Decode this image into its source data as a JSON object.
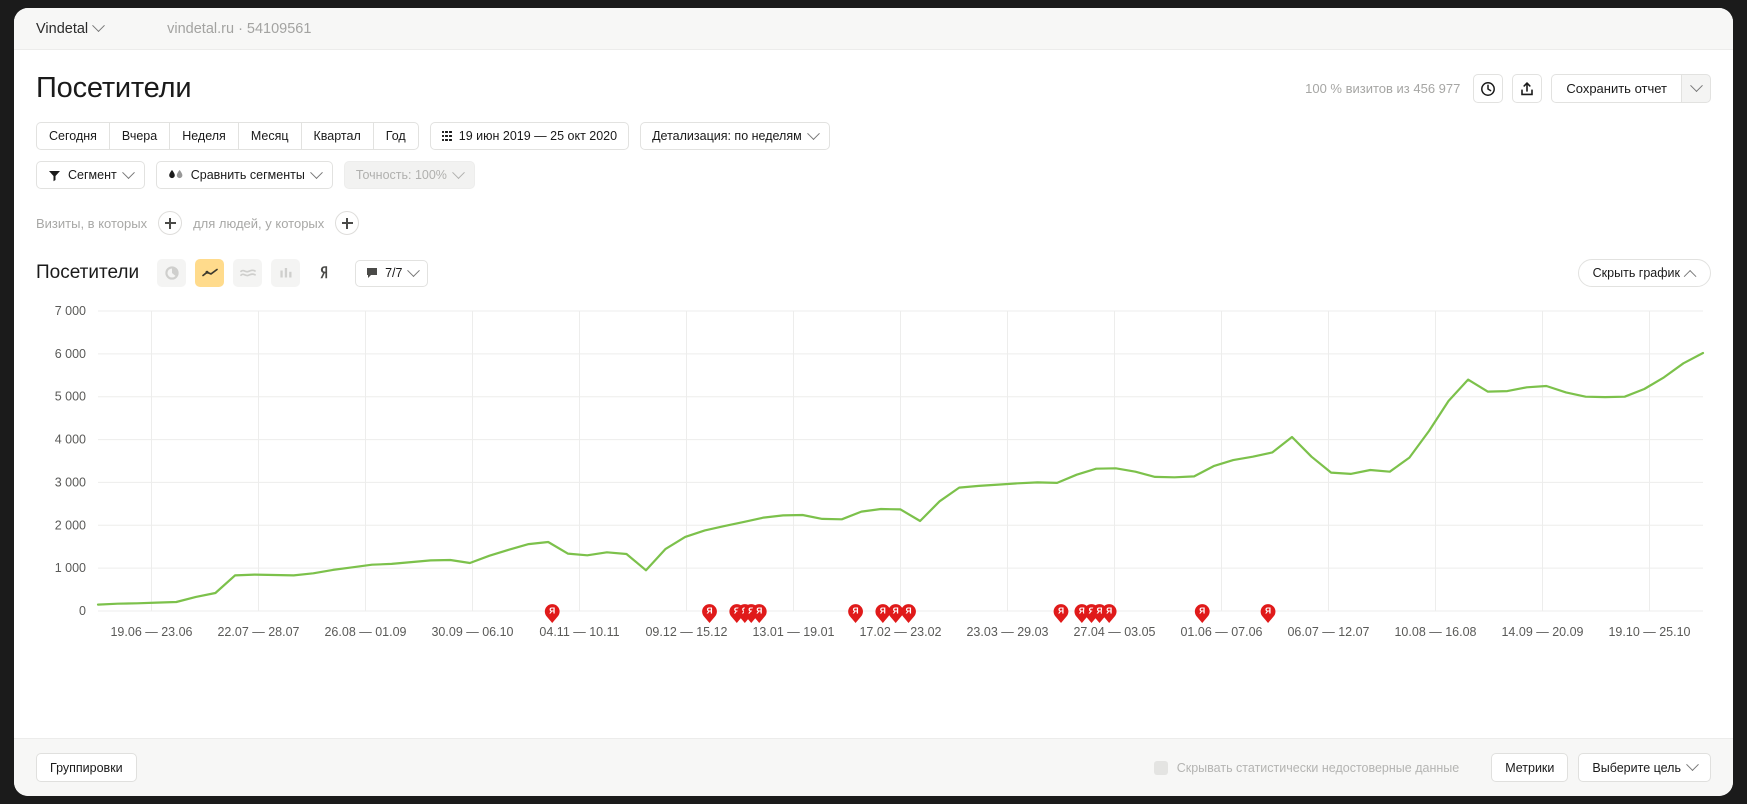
{
  "topbar": {
    "site_label": "Vindetal",
    "site_meta": "vindetal.ru · 54109561"
  },
  "header": {
    "page_title": "Посетители",
    "visits_note": "100 % визитов из 456 977",
    "clock_icon": "clock-icon",
    "share_icon": "share-icon",
    "save_label": "Сохранить отчет"
  },
  "periods": [
    {
      "label": "Сегодня"
    },
    {
      "label": "Вчера"
    },
    {
      "label": "Неделя"
    },
    {
      "label": "Месяц"
    },
    {
      "label": "Квартал"
    },
    {
      "label": "Год"
    }
  ],
  "daterange": {
    "label": "19 июн 2019 — 25 окт 2020",
    "icon": "calendar-grid-icon"
  },
  "detail": {
    "label": "Детализация: по неделям"
  },
  "segments": {
    "segment_label": "Сегмент",
    "compare_label": "Сравнить сегменты",
    "accuracy_label": "Точность: 100%"
  },
  "visit_filter": {
    "visits_text": "Визиты, в которых",
    "people_text": "для людей, у которых"
  },
  "chart_toolbar": {
    "title": "Посетители",
    "types": [
      {
        "name": "pie-chart-icon",
        "active": false
      },
      {
        "name": "line-chart-icon",
        "active": true
      },
      {
        "name": "area-chart-icon",
        "active": false
      },
      {
        "name": "bar-chart-icon",
        "active": false
      },
      {
        "name": "yandex-map-icon",
        "active": false
      }
    ],
    "comments_label": "7/7",
    "hide_chart_label": "Скрыть график"
  },
  "bottom": {
    "groupings_label": "Группировки",
    "hide_unreliable_label": "Скрывать статистически недостоверные данные",
    "metrics_label": "Метрики",
    "goal_label": "Выберите цель"
  },
  "colors": {
    "line": "#7cc14b",
    "accent": "#ffdb8c",
    "marker": "#e01a1a",
    "grid": "#ededec",
    "text": "#1a1a1a",
    "muted": "#a6a6a4"
  },
  "chart_data": {
    "type": "line",
    "title": "Посетители",
    "xlabel": "",
    "ylabel": "",
    "ylim": [
      0,
      7000
    ],
    "yticks": [
      "0",
      "1 000",
      "2 000",
      "3 000",
      "4 000",
      "5 000",
      "6 000",
      "7 000"
    ],
    "grid": true,
    "legend": "none",
    "xtick_labels": [
      "19.06 — 23.06",
      "22.07 — 28.07",
      "26.08 — 01.09",
      "30.09 — 06.10",
      "04.11 — 10.11",
      "09.12 — 15.12",
      "13.01 — 19.01",
      "17.02 — 23.02",
      "23.03 — 29.03",
      "27.04 — 03.05",
      "01.06 — 07.06",
      "06.07 — 12.07",
      "10.08 — 16.08",
      "14.09 — 20.09",
      "19.10 — 25.10"
    ],
    "series": [
      {
        "name": "Посетители",
        "color": "#7cc14b",
        "values": [
          150,
          170,
          180,
          195,
          210,
          330,
          420,
          830,
          850,
          840,
          830,
          880,
          960,
          1020,
          1080,
          1100,
          1140,
          1180,
          1190,
          1120,
          1290,
          1430,
          1560,
          1610,
          1340,
          1300,
          1370,
          1330,
          950,
          1450,
          1730,
          1880,
          1980,
          2080,
          2180,
          2230,
          2240,
          2150,
          2140,
          2320,
          2380,
          2370,
          2100,
          2560,
          2880,
          2920,
          2950,
          2980,
          3000,
          2990,
          3180,
          3320,
          3330,
          3250,
          3130,
          3120,
          3140,
          3380,
          3520,
          3600,
          3700,
          4060,
          3600,
          3230,
          3200,
          3290,
          3250,
          3580,
          4200,
          4900,
          5400,
          5120,
          5130,
          5220,
          5250,
          5100,
          5000,
          4990,
          5000,
          5180,
          5450,
          5780,
          6020
        ]
      }
    ],
    "annotations": {
      "marker_label": "Я",
      "positions": [
        0.283,
        0.381,
        0.398,
        0.403,
        0.407,
        0.412,
        0.472,
        0.489,
        0.497,
        0.505,
        0.6,
        0.613,
        0.619,
        0.624,
        0.63,
        0.688,
        0.729
      ]
    }
  }
}
